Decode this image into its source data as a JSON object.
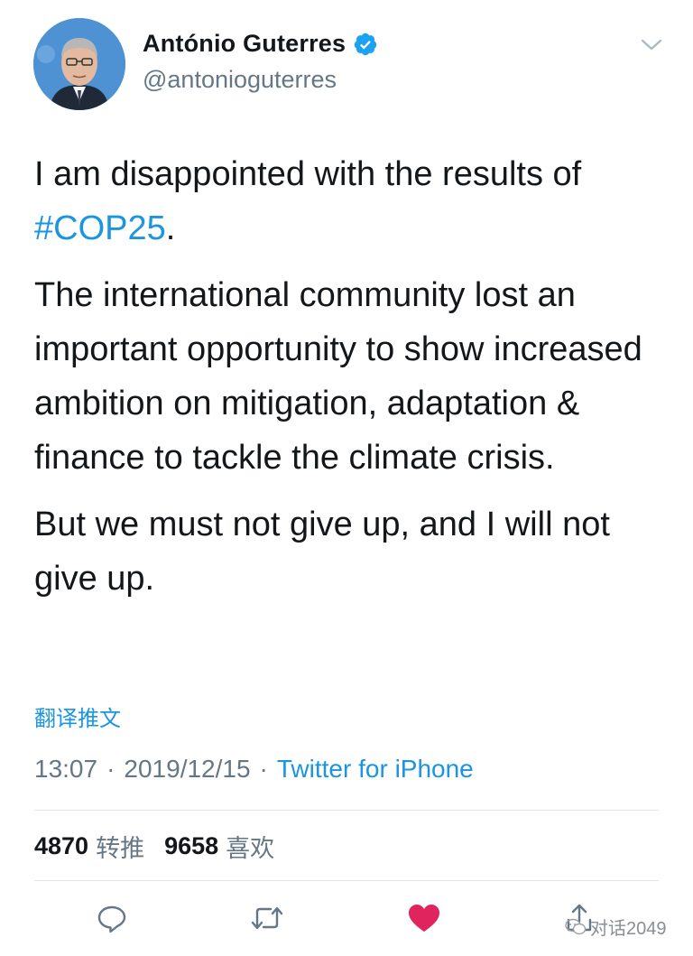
{
  "user": {
    "display_name": "António Guterres",
    "handle": "@antonioguterres",
    "verified_icon": "verified-badge-icon",
    "accent_color": "#1b95e0"
  },
  "tweet": {
    "para1_prefix": "I am disappointed with the results of",
    "hashtag": "#COP25",
    "para1_suffix": ".",
    "para2": "The international community lost an important opportunity to show increased ambition on mitigation, adaptation & finance to tackle the climate crisis.",
    "para3": "But we must not give up, and I will not give up."
  },
  "translate_label": "翻译推文",
  "meta": {
    "time": "13:07",
    "date": "2019/12/15",
    "separator": "·",
    "source": "Twitter for iPhone"
  },
  "stats": {
    "retweets_count": "4870",
    "retweets_label": "转推",
    "likes_count": "9658",
    "likes_label": "喜欢"
  },
  "actions": {
    "reply_icon": "reply-icon",
    "retweet_icon": "retweet-icon",
    "like_icon": "heart-icon",
    "share_icon": "share-icon",
    "like_color": "#e0245e"
  },
  "watermark": {
    "text": "对话2049"
  }
}
